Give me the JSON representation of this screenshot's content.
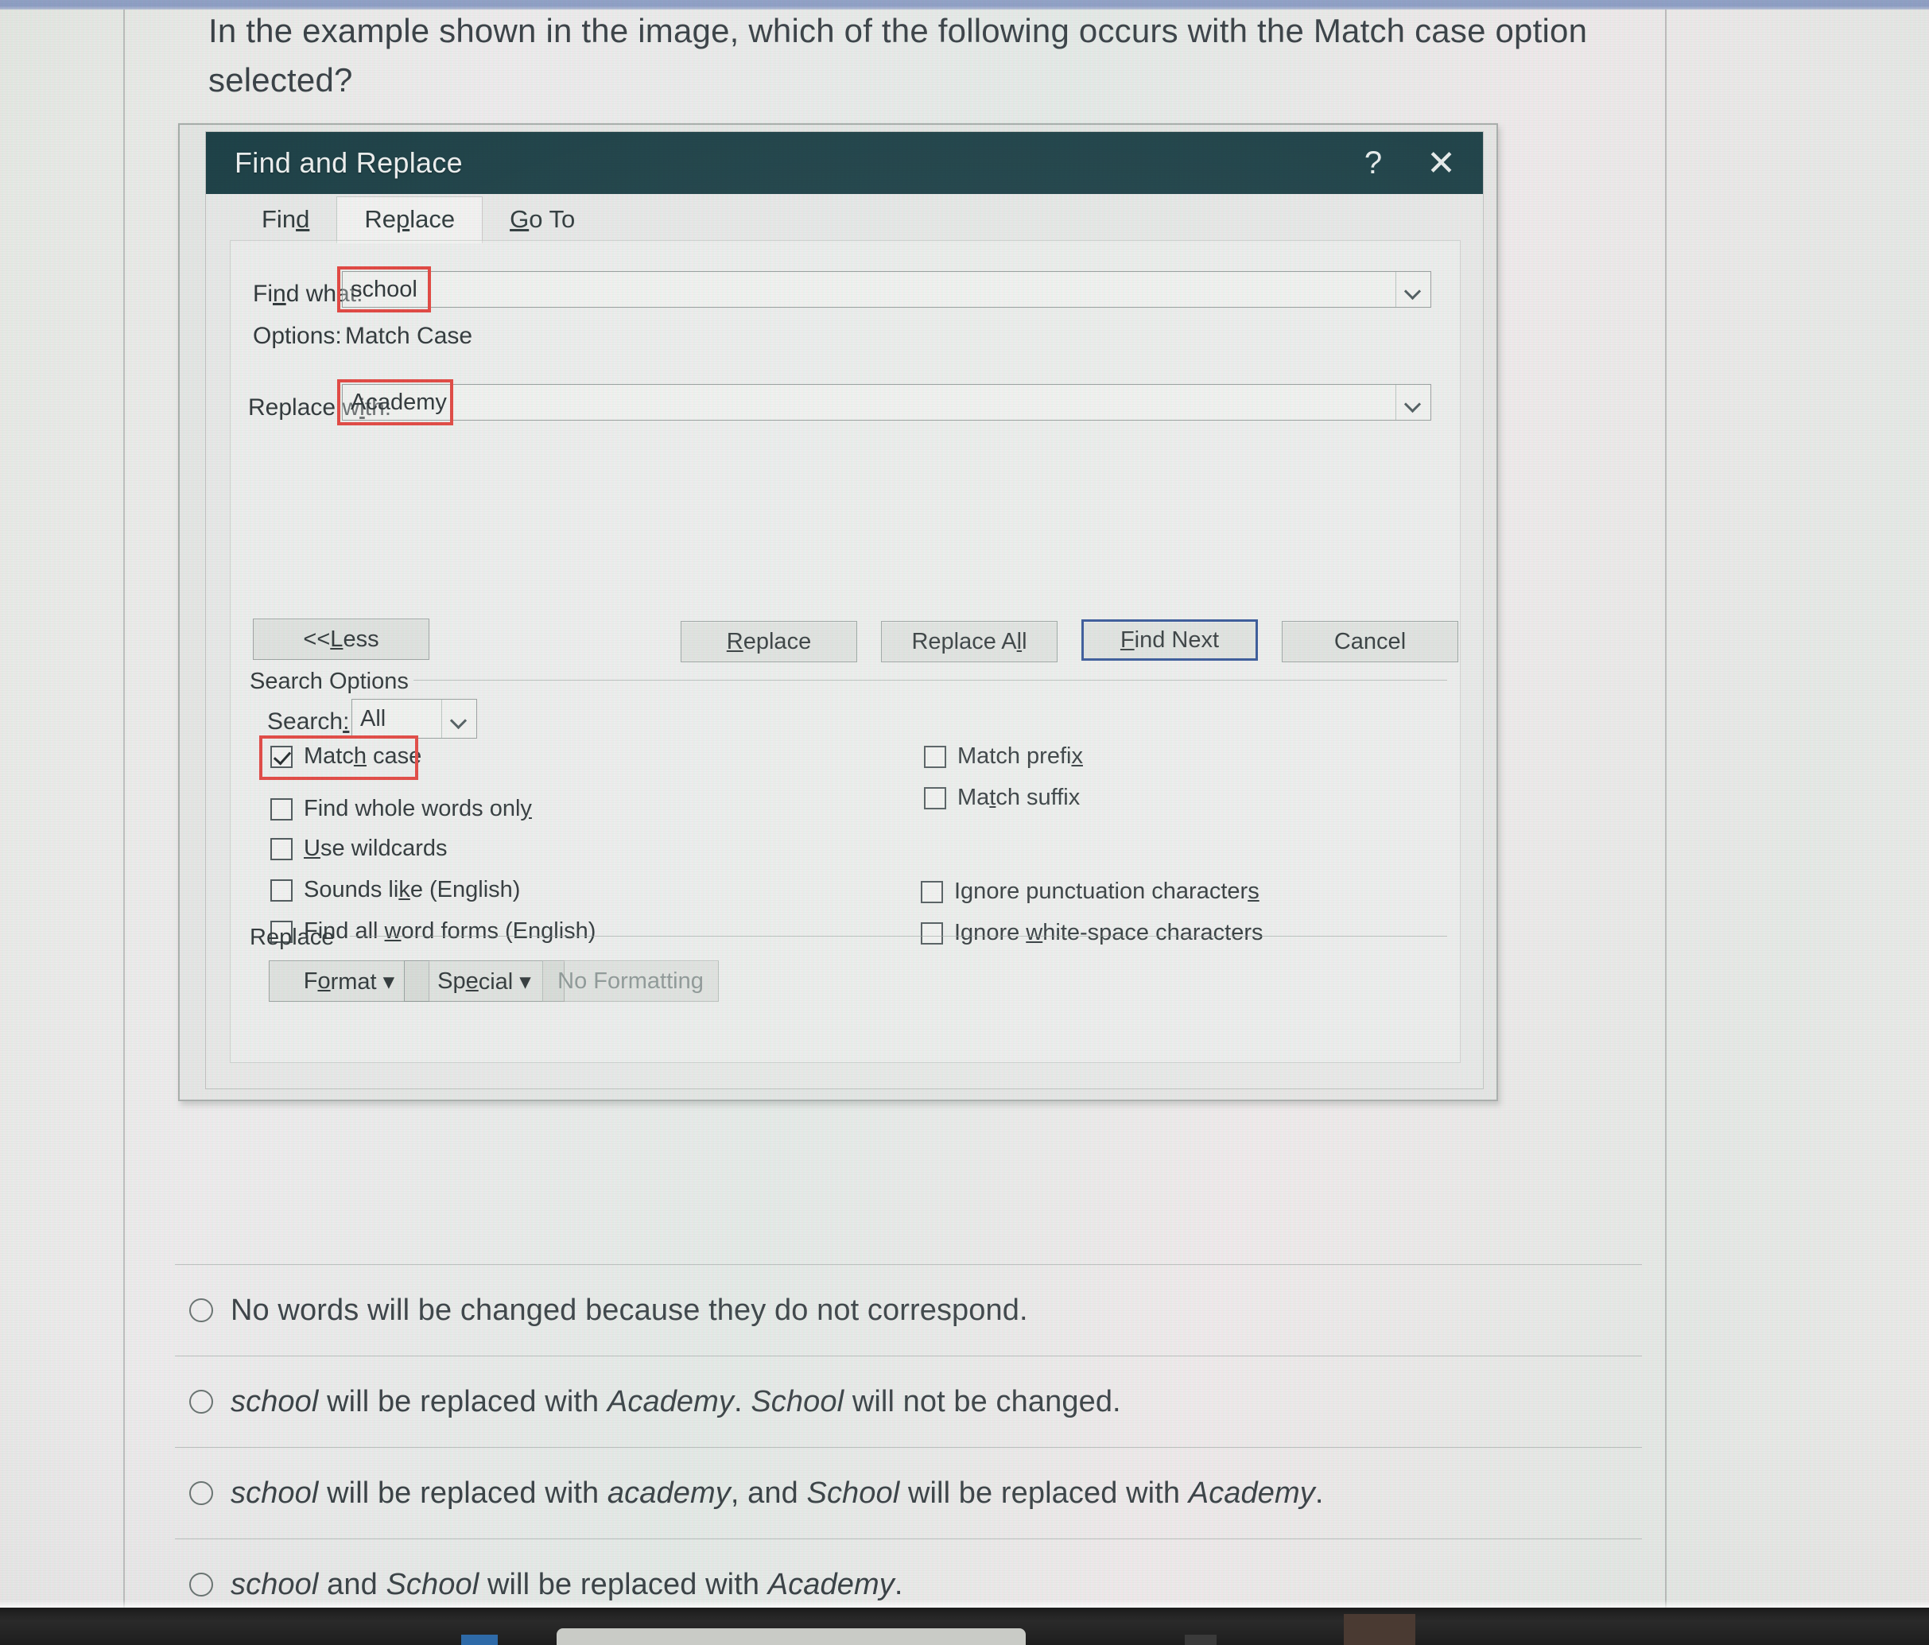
{
  "question": "In the example shown in the image, which of the following occurs with the Match case option selected?",
  "dialog": {
    "title": "Find and Replace",
    "help_icon_label": "?",
    "close_icon_label": "✕",
    "tabs": [
      {
        "label": "Find",
        "accel": "d",
        "active": false
      },
      {
        "label": "Replace",
        "accel": "p",
        "active": true
      },
      {
        "label": "Go To",
        "accel": "G",
        "active": false
      }
    ],
    "find_what_label": "Find what:",
    "find_what_value": "school",
    "options_label": "Options:",
    "options_value": "Match Case",
    "replace_with_label": "Replace with:",
    "replace_with_value": "Academy",
    "buttons": {
      "less": "<< Less",
      "replace": "Replace",
      "replace_all": "Replace All",
      "find_next": "Find Next",
      "cancel": "Cancel"
    },
    "search_options_label": "Search Options",
    "search_label": "Search:",
    "search_value": "All",
    "checkboxes_left": [
      {
        "label": "Match case",
        "checked": true,
        "highlighted": true
      },
      {
        "label": "Find whole words only",
        "checked": false,
        "highlighted": false
      },
      {
        "label": "Use wildcards",
        "checked": false,
        "highlighted": false
      },
      {
        "label": "Sounds like (English)",
        "checked": false,
        "highlighted": false
      },
      {
        "label": "Find all word forms (English)",
        "checked": false,
        "highlighted": false
      }
    ],
    "checkboxes_right": [
      {
        "label": "Match prefix",
        "checked": false
      },
      {
        "label": "Match suffix",
        "checked": false
      },
      {
        "label": "Ignore punctuation characters",
        "checked": false
      },
      {
        "label": "Ignore white-space characters",
        "checked": false
      }
    ],
    "replace_group_label": "Replace",
    "format_button": "Format ▾",
    "special_button": "Special ▾",
    "no_formatting_button": "No Formatting"
  },
  "answers": [
    {
      "text": "No words will be changed because they do not correspond.",
      "selected": false
    },
    {
      "text": "school will be replaced with Academy. School will not be changed.",
      "selected": false
    },
    {
      "text": "school will be replaced with academy, and School will be replaced with Academy.",
      "selected": false
    },
    {
      "text": "school and School will be replaced with Academy.",
      "selected": false
    }
  ],
  "colors": {
    "titlebar": "#1d4147",
    "annotation_red": "#e2453f",
    "focus_blue": "#2c4f93",
    "page_background": "#edefec"
  }
}
